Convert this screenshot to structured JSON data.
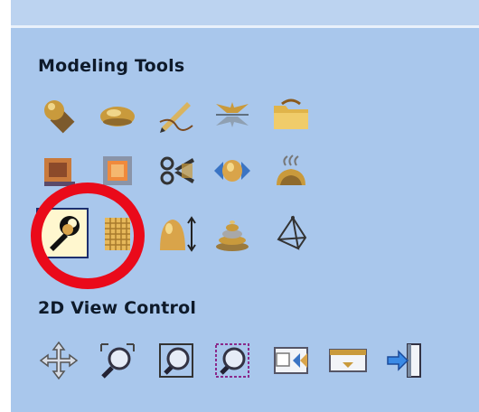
{
  "modeling_tools": {
    "title": "Modeling Tools",
    "tools": [
      {
        "icon": "sphere-on-cube-icon"
      },
      {
        "icon": "ellipsoid-icon"
      },
      {
        "icon": "pen-sketch-icon"
      },
      {
        "icon": "mirror-shape-icon"
      },
      {
        "icon": "folder-shape-icon"
      },
      {
        "icon": "flat-block-icon"
      },
      {
        "icon": "square-frame-icon"
      },
      {
        "icon": "scissors-icon"
      },
      {
        "icon": "blend-shape-icon"
      },
      {
        "icon": "smoothing-icon"
      },
      {
        "icon": "wrench-icon",
        "selected": true
      },
      {
        "icon": "texture-grid-icon"
      },
      {
        "icon": "dome-height-icon"
      },
      {
        "icon": "layered-dome-icon"
      },
      {
        "icon": "tetrahedron-icon"
      }
    ]
  },
  "view_control": {
    "title": "2D View Control",
    "tools": [
      {
        "icon": "pan-arrows-icon"
      },
      {
        "icon": "zoom-box-icon"
      },
      {
        "icon": "zoom-extents-icon"
      },
      {
        "icon": "zoom-selection-icon"
      },
      {
        "icon": "split-view-icon"
      },
      {
        "icon": "center-view-icon"
      },
      {
        "icon": "exit-view-icon"
      }
    ]
  },
  "colors": {
    "panel": "#a9c7ec",
    "highlight": "#ea0a1a",
    "selected_bg": "#fff7cf"
  }
}
